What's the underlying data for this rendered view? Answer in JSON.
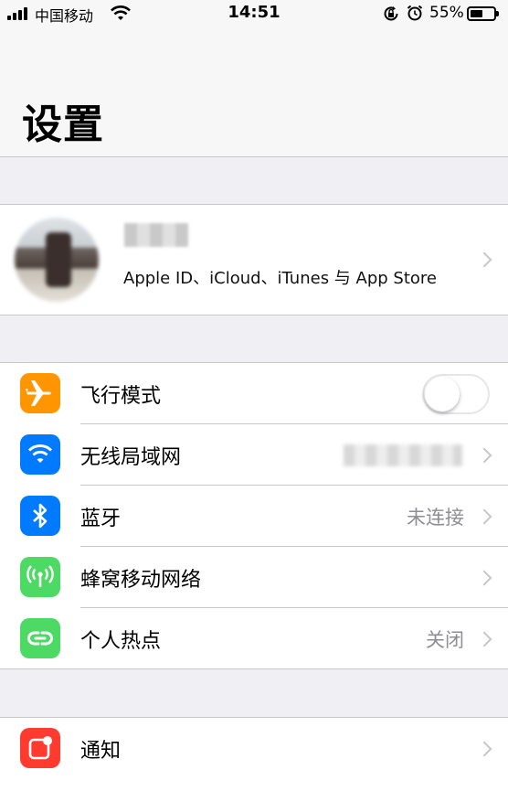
{
  "status_bar": {
    "carrier": "中国移动",
    "time": "14:51",
    "battery_percent": "55%",
    "battery_level": 0.55,
    "icons": [
      "signal-icon",
      "wifi-icon",
      "rotation-lock-icon",
      "alarm-icon",
      "battery-icon"
    ]
  },
  "header": {
    "title": "设置"
  },
  "profile": {
    "subtitle": "Apple ID、iCloud、iTunes 与 App Store",
    "icons": [
      "avatar",
      "chevron-right-icon"
    ]
  },
  "settings": [
    {
      "id": "airplane",
      "label": "飞行模式",
      "icon": "airplane-icon",
      "icon_color": "#ff9500",
      "toggle": false
    },
    {
      "id": "wifi",
      "label": "无线局域网",
      "icon": "wifi-icon",
      "icon_color": "#007aff"
    },
    {
      "id": "bluetooth",
      "label": "蓝牙",
      "value": "未连接",
      "icon": "bluetooth-icon",
      "icon_color": "#007aff"
    },
    {
      "id": "cellular",
      "label": "蜂窝移动网络",
      "icon": "antenna-icon",
      "icon_color": "#4cd964"
    },
    {
      "id": "hotspot",
      "label": "个人热点",
      "value": "关闭",
      "icon": "hotspot-icon",
      "icon_color": "#4cd964"
    },
    {
      "id": "notifications",
      "label": "通知",
      "icon": "notification-icon",
      "icon_color": "#ff3b30"
    }
  ]
}
